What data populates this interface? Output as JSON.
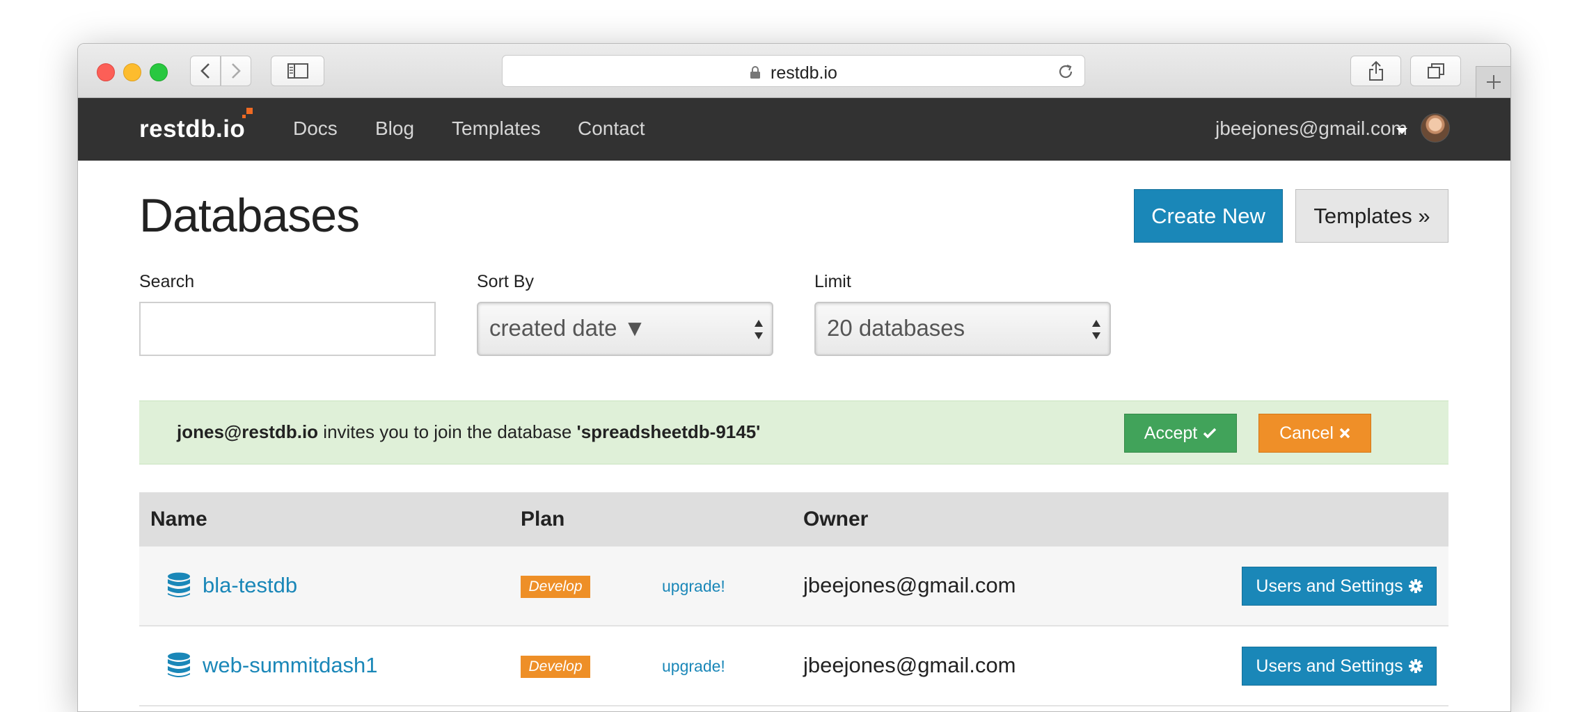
{
  "browser": {
    "url": "restdb.io"
  },
  "navbar": {
    "brand": "restdb.io",
    "links": [
      "Docs",
      "Blog",
      "Templates",
      "Contact"
    ],
    "user_email": "jbeejones@gmail.com"
  },
  "page": {
    "title": "Databases",
    "create_label": "Create New",
    "templates_label": "Templates »"
  },
  "filters": {
    "search_label": "Search",
    "search_value": "",
    "sort_label": "Sort By",
    "sort_value": "created date ▼",
    "limit_label": "Limit",
    "limit_value": "20 databases"
  },
  "invite": {
    "inviter": "jones@restdb.io",
    "text": " invites you to join the database ",
    "database": "'spreadsheetdb-9145'",
    "accept_label": "Accept",
    "cancel_label": "Cancel"
  },
  "table": {
    "headers": [
      "Name",
      "Plan",
      "Owner"
    ],
    "rows": [
      {
        "name": "bla-testdb",
        "plan": "Develop",
        "upgrade": "upgrade!",
        "owner": "jbeejones@gmail.com",
        "action": "Users and Settings"
      },
      {
        "name": "web-summitdash1",
        "plan": "Develop",
        "upgrade": "upgrade!",
        "owner": "jbeejones@gmail.com",
        "action": "Users and Settings"
      }
    ]
  },
  "colors": {
    "navbar": "#323232",
    "primary": "#1a87b8",
    "success": "#41a35a",
    "warning": "#ef8f28",
    "alert_bg": "#dff0d8"
  },
  "icons": [
    "lock-icon",
    "reload-icon",
    "share-icon",
    "tabs-icon",
    "sidebar-icon",
    "back-icon",
    "forward-icon",
    "database-icon",
    "checkmark-icon",
    "x-icon",
    "gear-icon"
  ]
}
